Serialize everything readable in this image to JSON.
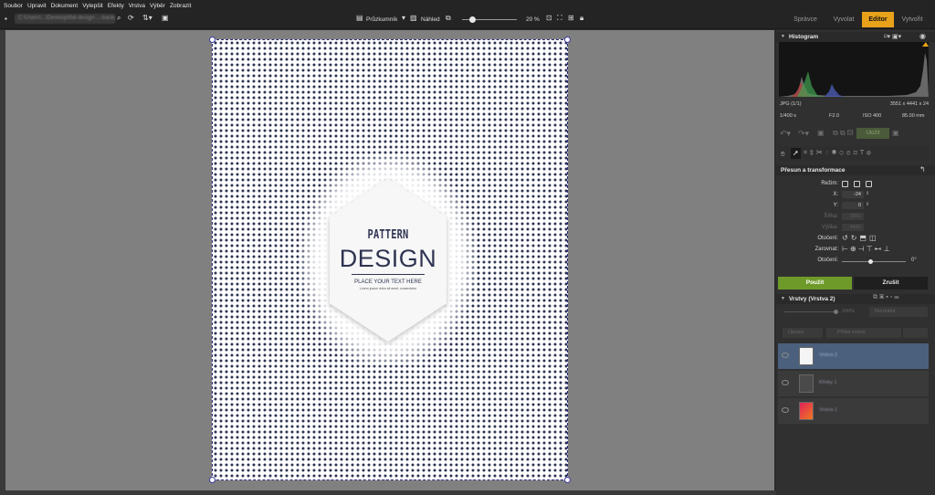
{
  "menu": [
    "Soubor",
    "Upravit",
    "Dokument",
    "Vylepšit",
    "Efekty",
    "Vrstva",
    "Výběr",
    "Zobrazit"
  ],
  "toolbar": {
    "path": "C:\\Users\\...\\Desktop\\flat-design-...-background.jpg",
    "explorer_label": "Průzkumník",
    "preview_label": "Náhled",
    "zoom": "20 %"
  },
  "mode_tabs": [
    {
      "label": "Správce",
      "active": false
    },
    {
      "label": "Vyvolat",
      "active": false
    },
    {
      "label": "Editor",
      "active": true
    },
    {
      "label": "Vytvořit",
      "active": false
    }
  ],
  "canvas": {
    "title": "PATTERN",
    "subtitle": "DESIGN",
    "tagline": "PLACE YOUR TEXT HERE",
    "small": "Lorem ipsum dolor sit amet, consectetur"
  },
  "histogram": {
    "title": "Histogram",
    "format": "JPG (1/1)",
    "dimensions": "3551 x 4441 x 24",
    "shutter": "1/400 s",
    "aperture": "F2.0",
    "iso": "ISO 400",
    "focal": "85.00 mm"
  },
  "actions": {
    "save_label": "Uložit"
  },
  "transform": {
    "title": "Přesun a transformace",
    "mode_label": "Režim:",
    "x_label": "X:",
    "x_value": "-24",
    "y_label": "Y:",
    "y_value": "0",
    "width_label": "Šířka:",
    "width_value": "3551",
    "height_label": "Výška:",
    "height_value": "4441",
    "rotate_label": "Otočení:",
    "align_label": "Zarovnat:",
    "rotation_label": "Otočení:",
    "rotation_value": "0°",
    "apply_label": "Použít",
    "cancel_label": "Zrušit"
  },
  "layers": {
    "title": "Vrstvy (Vrstva 2)",
    "opacity": "100%",
    "blend_mode": "Normální",
    "edit_label": "Úpravy",
    "add_label": "Přidat vrstvu",
    "items": [
      {
        "name": "Vrstva 2",
        "selected": true
      },
      {
        "name": "Křivky 1",
        "selected": false
      },
      {
        "name": "Vrstva 1",
        "selected": false
      }
    ]
  },
  "colors": {
    "accent": "#e8a21a",
    "apply": "#6e9a2a",
    "selected_layer": "#4b607c",
    "dots": "#2e3553"
  }
}
